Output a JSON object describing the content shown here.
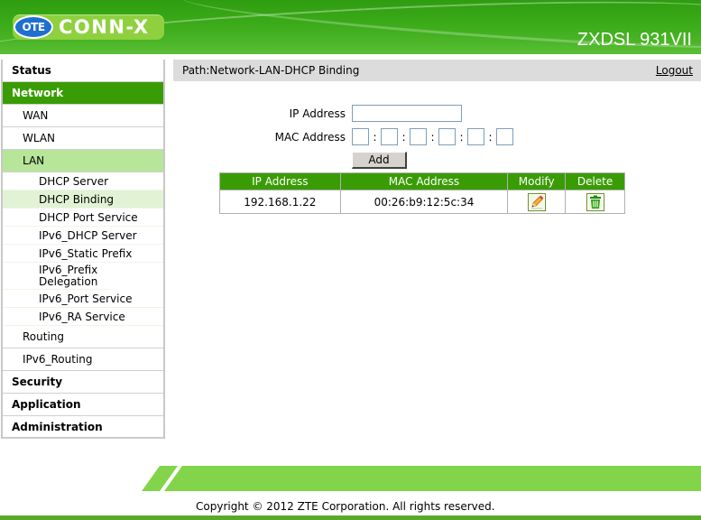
{
  "header": {
    "logo_badge": "OTE",
    "logo_text": "CONN-X",
    "model": "ZXDSL 931VII"
  },
  "sidebar": {
    "items": [
      {
        "label": "Status",
        "level": "top"
      },
      {
        "label": "Network",
        "level": "top",
        "state": "active"
      },
      {
        "label": "WAN",
        "level": "sub"
      },
      {
        "label": "WLAN",
        "level": "sub"
      },
      {
        "label": "LAN",
        "level": "sub",
        "state": "expanded"
      },
      {
        "label": "DHCP Server",
        "level": "leaf"
      },
      {
        "label": "DHCP Binding",
        "level": "leaf",
        "state": "selected"
      },
      {
        "label": "DHCP Port Service",
        "level": "leaf"
      },
      {
        "label": "IPv6_DHCP Server",
        "level": "leaf"
      },
      {
        "label": "IPv6_Static Prefix",
        "level": "leaf"
      },
      {
        "label": "IPv6_Prefix Delegation",
        "level": "leaf"
      },
      {
        "label": "IPv6_Port Service",
        "level": "leaf"
      },
      {
        "label": "IPv6_RA Service",
        "level": "leaf"
      },
      {
        "label": "Routing",
        "level": "sub"
      },
      {
        "label": "IPv6_Routing",
        "level": "sub"
      },
      {
        "label": "Security",
        "level": "top"
      },
      {
        "label": "Application",
        "level": "top"
      },
      {
        "label": "Administration",
        "level": "top"
      }
    ]
  },
  "pathbar": {
    "path": "Path:Network-LAN-DHCP Binding",
    "logout": "Logout"
  },
  "form": {
    "ip_label": "IP Address",
    "ip_value": "",
    "mac_label": "MAC Address",
    "mac_values": [
      "",
      "",
      "",
      "",
      "",
      ""
    ],
    "mac_separator": ":",
    "add_label": "Add"
  },
  "table": {
    "headers": [
      "IP Address",
      "MAC Address",
      "Modify",
      "Delete"
    ],
    "rows": [
      {
        "ip": "192.168.1.22",
        "mac": "00:26:b9:12:5c:34",
        "modify_icon": "pencil-edit-icon",
        "delete_icon": "trash-icon"
      }
    ]
  },
  "footer": {
    "copyright": "Copyright © 2012 ZTE Corporation. All rights reserved."
  },
  "colors": {
    "brand_green": "#3a9c04",
    "lan_highlight": "#b7e59a",
    "selected_leaf": "#e1f3d4",
    "footer_band": "#82d54b",
    "bottom_bar": "#5aa92a",
    "pathbar_bg": "#dcdcdc"
  }
}
